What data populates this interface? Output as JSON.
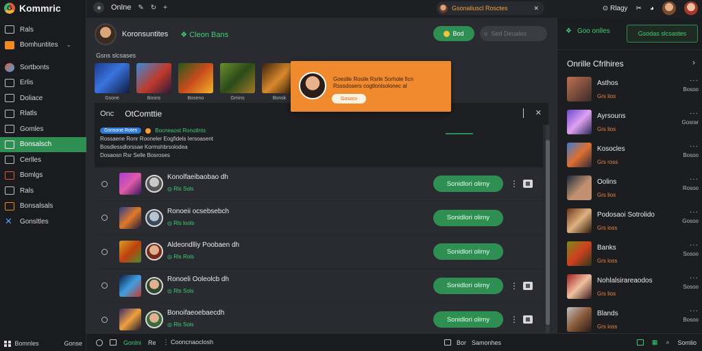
{
  "app": {
    "name": "Kommric",
    "logo_letter": "G"
  },
  "sidebar": {
    "items": [
      {
        "label": "Rals",
        "icon": "monitor-icon"
      },
      {
        "label": "Bomhuntites",
        "icon": "controller-icon",
        "chevron": "⌄"
      },
      {
        "label": "Sortbonts",
        "icon": "globe-icon"
      },
      {
        "label": "Erlis",
        "icon": "folder-icon"
      },
      {
        "label": "Doliace",
        "icon": "chat-icon"
      },
      {
        "label": "Rlatls",
        "icon": "list-icon"
      },
      {
        "label": "Gomles",
        "icon": "gamepad-icon"
      },
      {
        "label": "Bonsalsch",
        "icon": "store-icon",
        "active": true
      },
      {
        "label": "Cerlles",
        "icon": "users-icon"
      },
      {
        "label": "Bomlgs",
        "icon": "chart-icon"
      },
      {
        "label": "Rals",
        "icon": "card-icon"
      },
      {
        "label": "Bonsalsals",
        "icon": "shuffle-icon"
      },
      {
        "label": "Gonsltles",
        "icon": "tools-icon"
      }
    ],
    "footer_left": "Bomnles",
    "footer_right": "Gonse"
  },
  "topbar": {
    "status": "Onlne",
    "notification": "Gsonaliuscl Rosctes",
    "right_label": "Rlagy"
  },
  "main": {
    "user_name": "Koronsuntites",
    "user_sub": "Cleon Bans",
    "online_button": "Bod",
    "search_placeholder": "Sed Deuales",
    "section_label": "Gsns slcsases",
    "games": [
      "Gsone",
      "Bosns",
      "Boseno",
      "Gmins",
      "Bonsk"
    ],
    "popup": {
      "message": "Goeslle Rosile Rsrle Sorhole ficn Rsssdosers cogtlonlsolonec al",
      "button": "Gosoco"
    },
    "chat": {
      "label": "Onc",
      "title": "OtComttie",
      "badge": "Gsnsone Rotes",
      "green_text": "Bocneaost Ronotlnts",
      "lines": [
        "Rossaene Ronr Rooneler Eogfidels Iersoasent",
        "Bosdlessdlorssae Kormshbrsolodea",
        "Dosaosn Rsr Selle Bosroses"
      ]
    },
    "rows": [
      {
        "title": "Konolfaeibaobao dh",
        "meta": "Rls Sols",
        "action": "Sonidlori olirny",
        "has_square": true
      },
      {
        "title": "Ronoeii ocsebsebch",
        "meta": "Rls lools",
        "action": "Sonidlori olirny",
        "has_square": false
      },
      {
        "title": "Aldeondlliy Poobaen dh",
        "meta": "Rls Rols",
        "action": "Sonidlori olirny",
        "has_square": false
      },
      {
        "title": "Ronoeli Ooleolcb dh",
        "meta": "Rls Sols",
        "action": "Sonidlori olirny",
        "has_square": true
      },
      {
        "title": "Bonoifaeoebaecdh",
        "meta": "Rls Sols",
        "action": "Sonidlori olirny",
        "has_square": true
      }
    ]
  },
  "rightbar": {
    "top_label": "Goo onlles",
    "top_button": "Gsodas slcsastes",
    "title": "Onrille Cfrlhires",
    "friends": [
      {
        "name": "Asthos",
        "status": "Grs iios",
        "time": "Bosoo"
      },
      {
        "name": "Ayrsouns",
        "status": "Grs lios",
        "time": "Gosrar"
      },
      {
        "name": "Kosocles",
        "status": "Grs ross",
        "time": "Bosoo"
      },
      {
        "name": "Oolins",
        "status": "Grs lios",
        "time": "Rosoo"
      },
      {
        "name": "Podosaoi Sotrolido",
        "status": "Grs ioss",
        "time": "Gosoo"
      },
      {
        "name": "Banks",
        "status": "Grs ioss",
        "time": "Sosoo"
      },
      {
        "name": "Nohlalsirareaodos",
        "status": "Grs lios",
        "time": "Sosoo"
      },
      {
        "name": "Blands",
        "status": "Grs ioss",
        "time": "Bosoo"
      }
    ]
  },
  "bottombar": {
    "left_a": "Gonlni",
    "left_b": "Cooncnaoclosh",
    "left_prefix": "Re",
    "mid_prefix": "Bor",
    "mid": "Samonhes",
    "right": "Somlio"
  },
  "colors": {
    "accent_green": "#2f8f52",
    "accent_orange": "#f08a2e",
    "bg": "#1e1f23"
  }
}
